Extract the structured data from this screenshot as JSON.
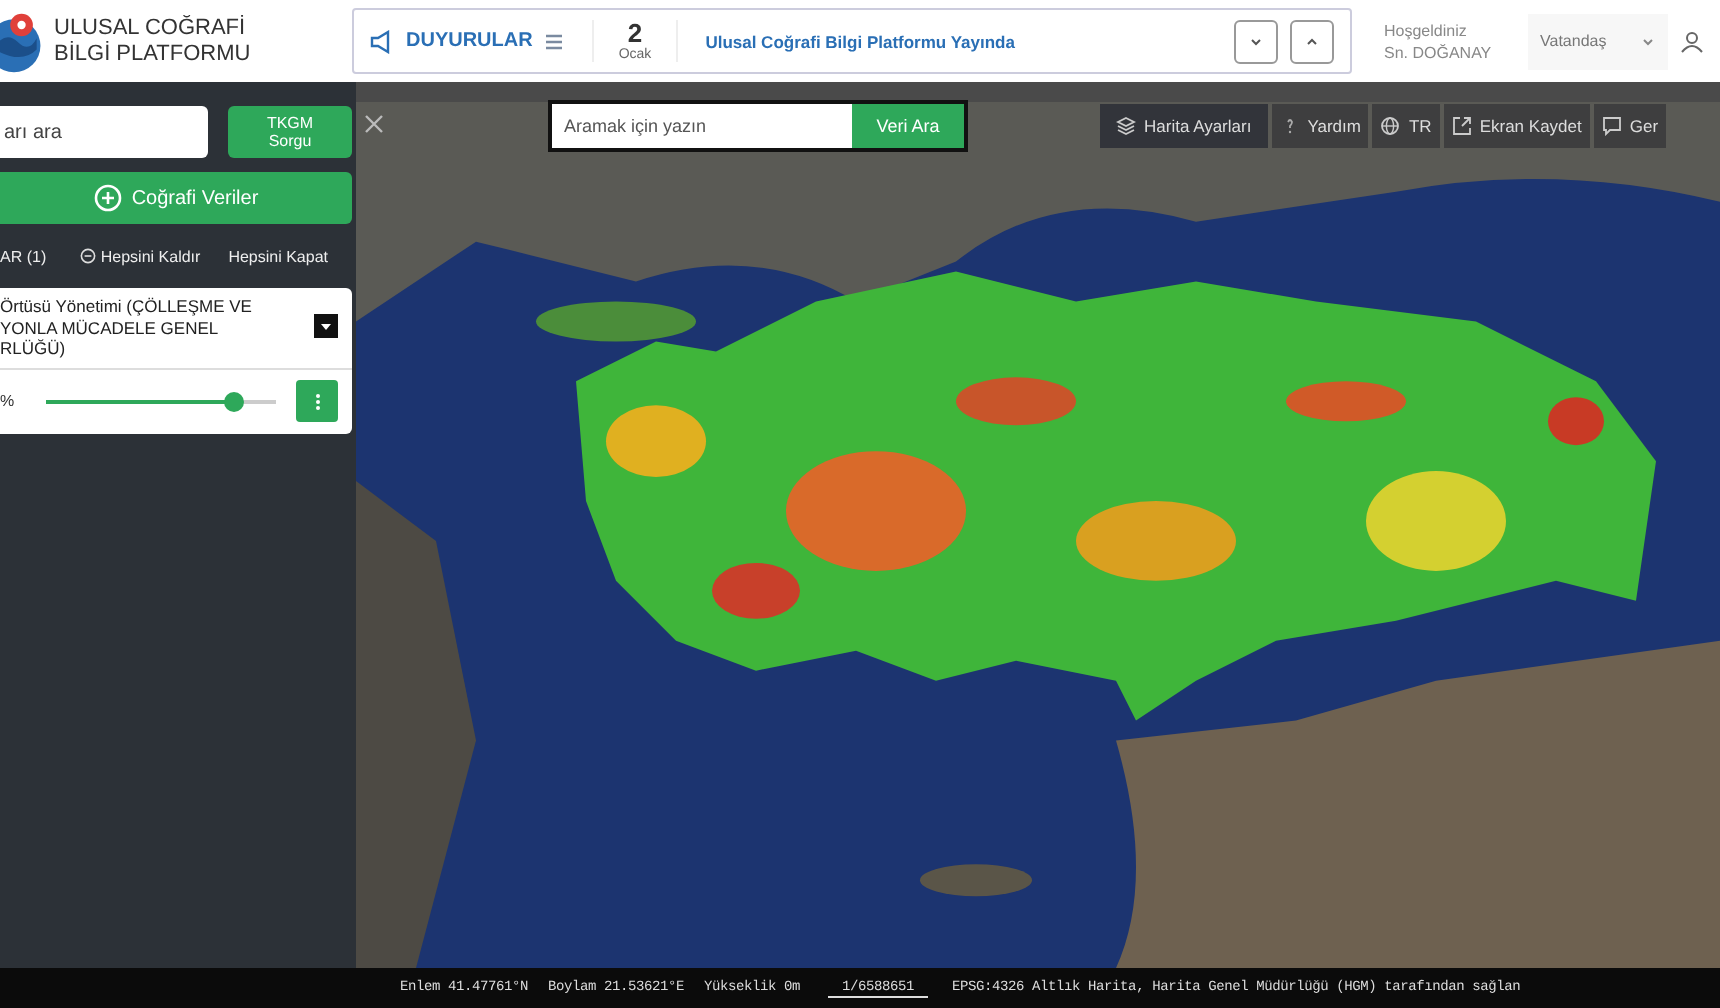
{
  "header": {
    "logo_lines": [
      "ULUSAL COĞRAFİ",
      "BİLGİ PLATFORMU"
    ],
    "announcements": {
      "label": "DUYURULAR",
      "day": "2",
      "month": "Ocak",
      "text": "Ulusal Coğrafi Bilgi Platformu Yayında"
    },
    "greeting": "Hoşgeldiniz",
    "user": "Sn. DOĞANAY",
    "role": "Vatandaş"
  },
  "sidebar": {
    "search": {
      "placeholder": "arı ara"
    },
    "query_button": "TKGM Sorgu",
    "add_button": "Coğrafi Veriler",
    "layers_tab": "AR (1)",
    "actions": [
      {
        "label": "Hepsini Kaldır",
        "kind": "remove"
      },
      {
        "label": "Hepsini Kapat",
        "kind": "close"
      }
    ],
    "layers": [
      {
        "title": "Örtüsü Yönetimi (ÇÖLLEŞME VE YONLA MÜCADELE GENEL RLÜĞÜ)",
        "opacity": "%",
        "level": 0.82
      }
    ]
  },
  "map": {
    "search": {
      "placeholder": "Aramak için yazın"
    },
    "search_button": "Veri Ara",
    "tools": [
      {
        "label": "Harita Ayarları",
        "kind": "layers"
      },
      {
        "label": "Yardım",
        "kind": "help"
      },
      {
        "label": "TR",
        "kind": "globe"
      },
      {
        "label": "Ekran Kaydet",
        "kind": "export"
      },
      {
        "label": "Ger",
        "kind": "comment"
      }
    ]
  },
  "status_bar": {
    "items": [
      {
        "label": "Enlem",
        "value": "41.47761°N"
      },
      {
        "label": "Boylam",
        "value": "21.53621°E"
      },
      {
        "label": "Yükseklik",
        "value": "0m"
      }
    ],
    "scale": "1/6588651",
    "attribution": "EPSG:4326 Altlık Harita, Harita Genel Müdürlüğü (HGM) tarafından sağlan"
  }
}
